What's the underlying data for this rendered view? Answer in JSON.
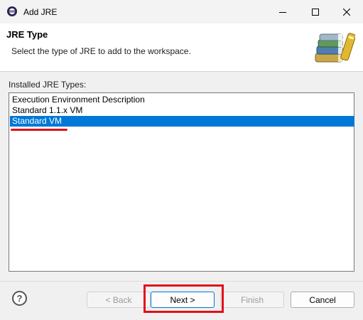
{
  "window": {
    "title": "Add JRE"
  },
  "header": {
    "title": "JRE Type",
    "description": "Select the type of JRE to add to the workspace."
  },
  "list": {
    "label": "Installed JRE Types:",
    "items": [
      {
        "label": "Execution Environment Description",
        "selected": false
      },
      {
        "label": "Standard 1.1.x VM",
        "selected": false
      },
      {
        "label": "Standard VM",
        "selected": true
      }
    ]
  },
  "buttons": {
    "help": "?",
    "back": "< Back",
    "next": "Next >",
    "finish": "Finish",
    "cancel": "Cancel"
  },
  "colors": {
    "selection": "#0078d7",
    "highlight": "#e0101a"
  },
  "icons": {
    "app": "eclipse-icon",
    "banner": "books-icon",
    "help": "help-icon"
  }
}
